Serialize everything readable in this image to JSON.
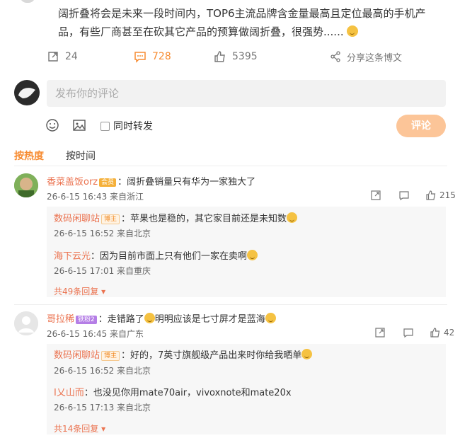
{
  "post": {
    "text": "阔折叠将会是未来一段时间内，TOP6主流品牌含金量最高且定位最高的手机产品，有些厂商甚至在砍其它产品的预算做阔折叠，很强势......",
    "reposts": "24",
    "comments": "728",
    "likes": "5395",
    "share_label": "分享这条博文"
  },
  "composer": {
    "placeholder": "发布你的评论",
    "forward_label": "同时转发",
    "submit_label": "评论"
  },
  "sort": {
    "hot": "按热度",
    "time": "按时间"
  },
  "comments": [
    {
      "user": "香菜盖饭orz",
      "badge": "会员",
      "text": "：阔折叠销量只有华为一家独大了",
      "meta": "26-6-15 16:43 来自浙江",
      "likes": "215",
      "replies": [
        {
          "user": "数码闲聊站",
          "badge": "博主",
          "text": "：苹果也是稳的，其它家目前还是未知数",
          "meta": "26-6-15 16:52 来自北京"
        },
        {
          "user": "海下云光",
          "badge": "",
          "text": "：因为目前市面上只有他们一家在卖啊",
          "meta": "26-6-15 17:01 来自重庆"
        }
      ],
      "more": "共49条回复"
    },
    {
      "user": "哥拉稀",
      "badge": "铁粉2",
      "text1": "：走错路了",
      "text2": "明明应该是七寸屏才是蓝海",
      "meta": "26-6-15 16:45 来自广东",
      "likes": "42",
      "replies": [
        {
          "user": "数码闲聊站",
          "badge": "博主",
          "text": "：好的，7英寸旗舰级产品出来时你给我晒单",
          "meta": "26-6-15 16:52 来自北京"
        },
        {
          "user": "I乂山而",
          "badge": "",
          "text": "：也没见你用mate70air，vivoxnote和mate20x",
          "meta": "26-6-15 17:13 来自北京"
        }
      ],
      "more": "共14条回复"
    }
  ],
  "colors": {
    "accent": "#f78c32",
    "username": "#eb7350",
    "submit": "#fcc598"
  }
}
